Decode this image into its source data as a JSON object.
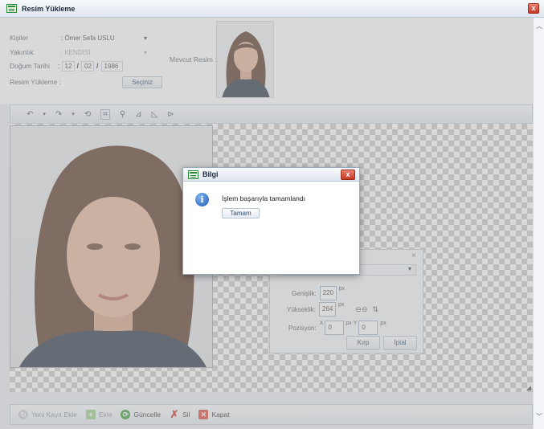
{
  "window": {
    "title": "Resim Yükleme",
    "close_glyph": "x"
  },
  "form": {
    "kisiler_label": "Kişiler",
    "kisiler_value": ": Ömer Sefa USLU",
    "yakinlik_label": "Yakınlık",
    "yakinlik_value": ": KENDİSİ",
    "dogum_label": "Doğum Tarihi",
    "dogum_day": "12",
    "dogum_month": "02",
    "dogum_year": "1986",
    "sep": "/",
    "resim_label": "Resim Yükleme :",
    "sec_button": "Seçiniz",
    "mevcut_label": "Mevcut Resim :"
  },
  "crop": {
    "close": "×",
    "genislik_label": "Genişlik:",
    "genislik_value": "220",
    "yukseklik_label": "Yükseklik:",
    "yukseklik_value": "264",
    "pozisyon_label": "Pozisyon:",
    "x_label": "X",
    "x_value": "0",
    "y_label": "px Y",
    "y_value": "0",
    "px": "px",
    "kirp_button": "Kırp",
    "iptal_button": "İptal"
  },
  "bottom": {
    "yeni_kayit": "Yeni Kayıt Ekle",
    "ekle": "Ekle",
    "guncelle": "Güncelle",
    "sil": "Sil",
    "kapat": "Kapat"
  },
  "dialog": {
    "title": "Bilgi",
    "close_glyph": "x",
    "message": "İşlem başarıyla tamamlandı",
    "ok": "Tamam"
  },
  "colors": {
    "accent": "#1f5fb8",
    "close": "#c53a25"
  }
}
